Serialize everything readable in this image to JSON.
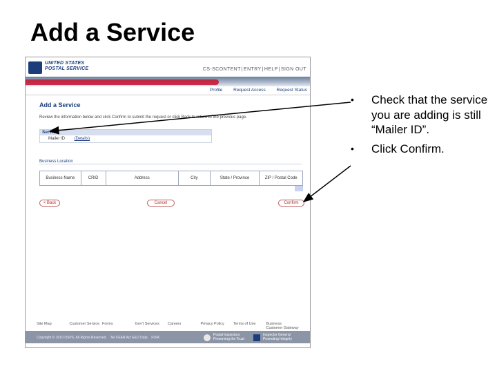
{
  "slide_title": "Add a Service",
  "screenshot": {
    "logo_line1": "UNITED STATES",
    "logo_line2": "POSTAL SERVICE",
    "util_nav": [
      "CS-SCONTENT",
      "ENTRY",
      "HELP",
      "SIGN OUT"
    ],
    "sub_nav": [
      "Profile",
      "Request Access",
      "Request Status"
    ],
    "page_title": "Add a Service",
    "instruction": "Review the information below and click Confirm to submit the request or click Back to return to the previous page.",
    "service_header": "Service",
    "service_label": "Mailer ID",
    "service_link": "(Details)",
    "business_location_title": "Business Location",
    "table_columns": [
      "Business Name",
      "CRID",
      "Address",
      "City",
      "State / Province",
      "ZIP / Postal Code"
    ],
    "back_button": "< Back",
    "cancel_button": "Cancel",
    "confirm_button": "Confirm",
    "footer_links": [
      "Site Map",
      "Customer Service",
      "Forms",
      "Gov't Services",
      "Careers",
      "Privacy Policy",
      "Terms of Use",
      "Business Customer Gateway"
    ],
    "footer_copy": "Copyright © 2010 USPS. All Rights Reserved.",
    "footer_copy2": "No FEAR Act EEO Data",
    "footer_copy3": "FOIA",
    "footer_badge1": "Postal Inspectors Preserving the Trust",
    "footer_badge2": "Inspector General Promoting Integrity"
  },
  "bullets": [
    "Check that the service you are adding is still “Mailer ID”.",
    "Click Confirm."
  ],
  "colors": {
    "usps_blue": "#1b3e7b",
    "usps_red": "#c8102e",
    "button_red": "#b03030"
  }
}
